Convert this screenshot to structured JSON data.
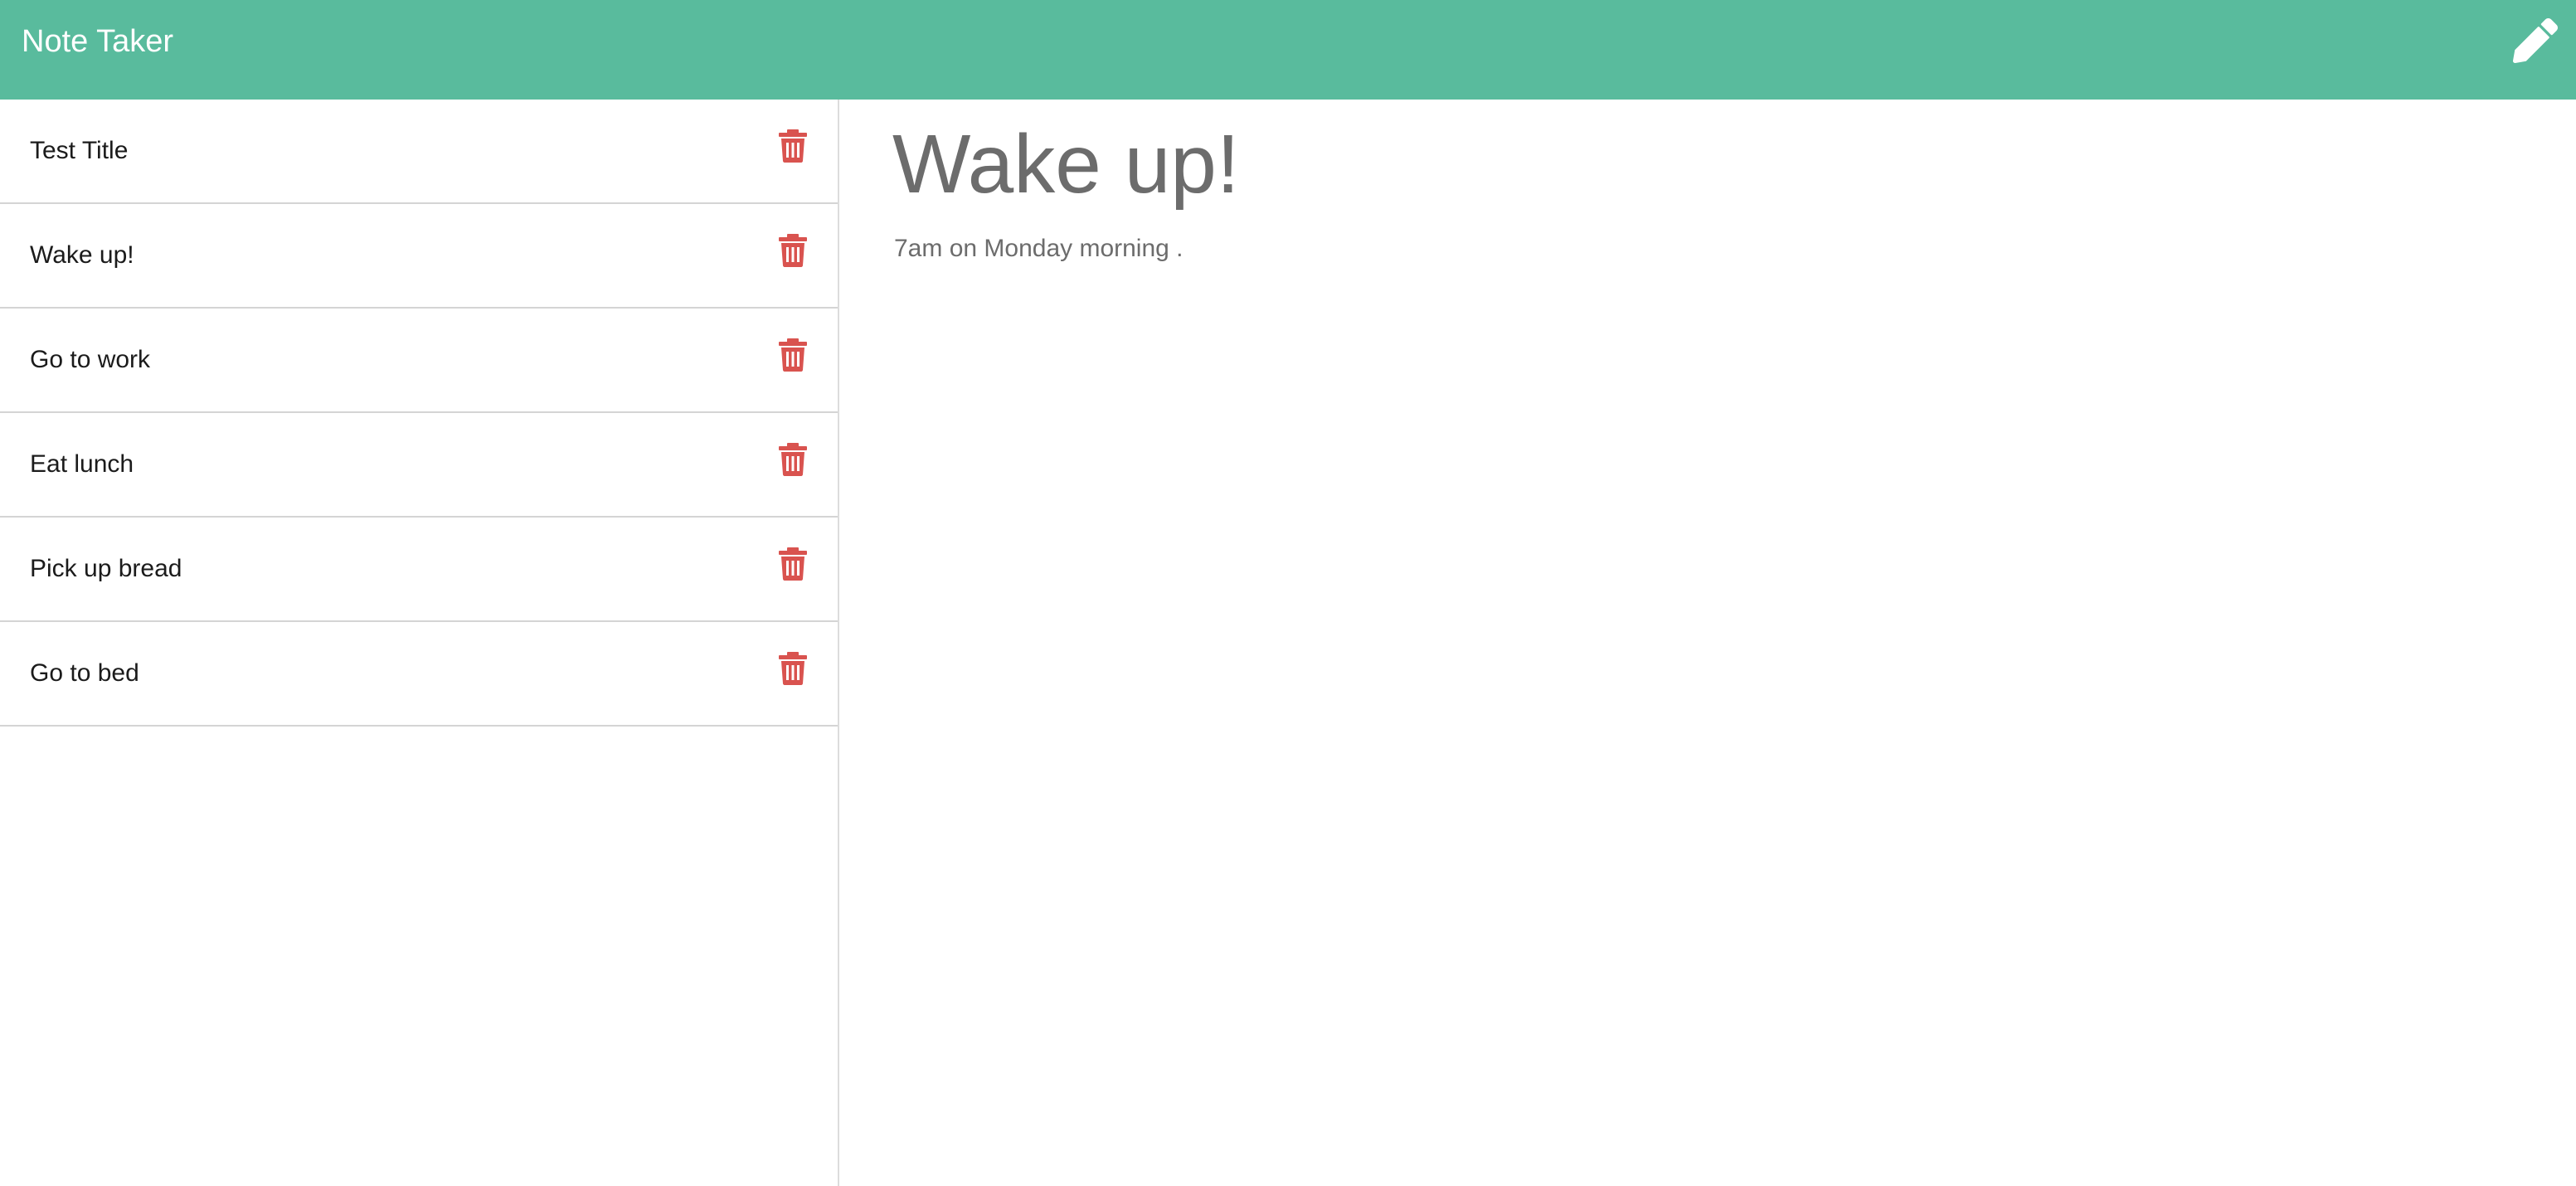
{
  "app": {
    "title": "Note Taker"
  },
  "toolbar": {
    "new_note_icon": "pencil-icon"
  },
  "sidebar": {
    "delete_icon": "trash-icon",
    "delete_color": "#d9534f",
    "notes": [
      {
        "title": "Test Title"
      },
      {
        "title": "Wake up!"
      },
      {
        "title": "Go to work"
      },
      {
        "title": "Eat lunch"
      },
      {
        "title": "Pick up bread"
      },
      {
        "title": "Go to bed"
      }
    ]
  },
  "active_note": {
    "title": "Wake up!",
    "text": "7am on Monday morning ."
  },
  "colors": {
    "navbar": "#59bb9d",
    "text_muted": "#6c6c6c"
  }
}
